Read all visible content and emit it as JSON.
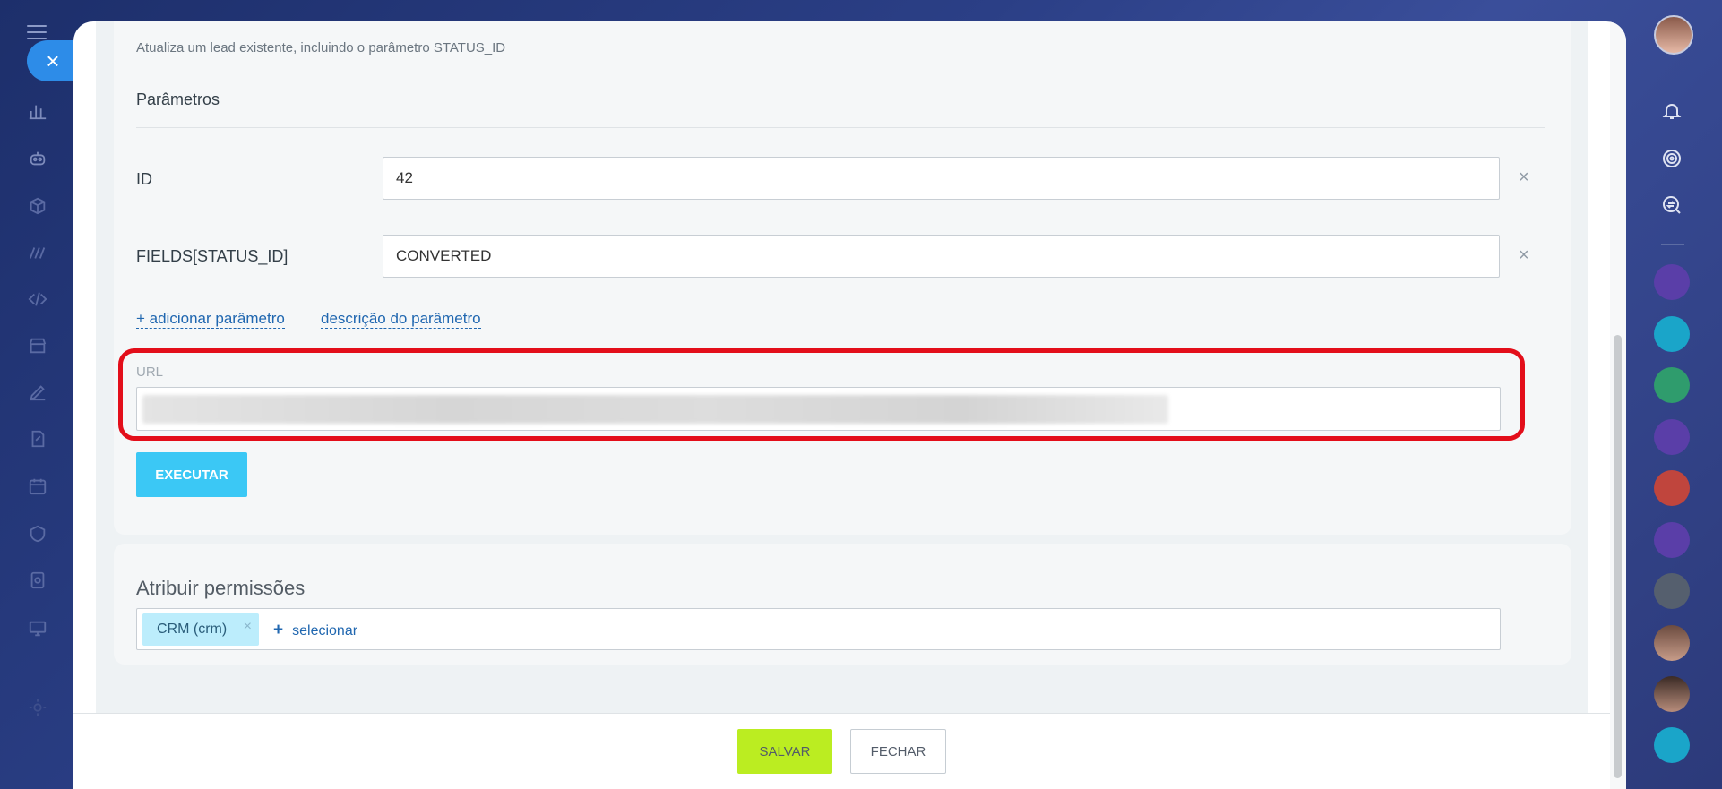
{
  "method": {
    "description": "Atualiza um lead existente, incluindo o parâmetro STATUS_ID"
  },
  "params": {
    "title": "Parâmetros",
    "rows": [
      {
        "name": "ID",
        "value": "42",
        "remove": "×"
      },
      {
        "name": "FIELDS[STATUS_ID]",
        "value": "CONVERTED",
        "remove": "×"
      }
    ],
    "add_param": "+ adicionar parâmetro",
    "param_desc": "descrição do parâmetro"
  },
  "url": {
    "label": "URL"
  },
  "execute_label": "EXECUTAR",
  "permissions": {
    "title": "Atribuir permissões",
    "tags": [
      {
        "label": "CRM (crm)",
        "remove": "×"
      }
    ],
    "select_plus": "+",
    "select_label": "selecionar"
  },
  "footer": {
    "save_label": "SALVAR",
    "close_label": "FECHAR"
  },
  "close_icon": "×",
  "colors": {
    "accent": "#3bc8f5",
    "save": "#bbed21",
    "highlight": "#e30e1a",
    "link": "#2067b0"
  }
}
